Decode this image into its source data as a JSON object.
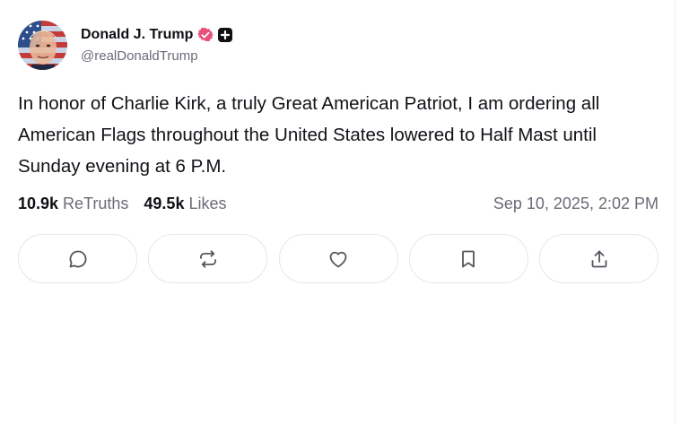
{
  "post": {
    "author": {
      "display_name": "Donald J. Trump",
      "handle": "@realDonaldTrump",
      "verified_badge_color": "#e8507a",
      "avatar_icon": "avatar-flag-portrait"
    },
    "text": "In honor of Charlie Kirk, a truly Great American Patriot, I am ordering all American Flags throughout the United States lowered to Half Mast until Sunday evening at 6 P.M.",
    "stats": {
      "retruths_count": "10.9k",
      "retruths_label": "ReTruths",
      "likes_count": "49.5k",
      "likes_label": "Likes"
    },
    "timestamp": "Sep 10, 2025, 2:02 PM",
    "actions": [
      {
        "name": "reply",
        "icon": "comment-icon"
      },
      {
        "name": "retruth",
        "icon": "repost-icon"
      },
      {
        "name": "like",
        "icon": "heart-icon"
      },
      {
        "name": "bookmark",
        "icon": "bookmark-icon"
      },
      {
        "name": "share",
        "icon": "share-icon"
      }
    ]
  },
  "colors": {
    "text_primary": "#0f0f14",
    "text_secondary": "#6b6b78",
    "border": "#e6e6ea"
  }
}
